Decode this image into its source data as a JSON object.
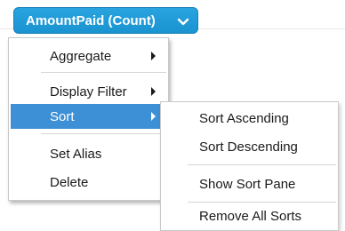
{
  "field_pill": {
    "label": "AmountPaid (Count)",
    "caret_icon": "chevron-down-icon",
    "color": "#1f9ad8"
  },
  "context_menu": {
    "items": [
      {
        "label": "Aggregate",
        "has_submenu": true
      },
      {
        "label": "Display Filter",
        "has_submenu": true
      },
      {
        "label": "Sort",
        "has_submenu": true,
        "highlighted": true
      },
      {
        "label": "Set Alias",
        "has_submenu": false
      },
      {
        "label": "Delete",
        "has_submenu": false
      }
    ],
    "highlight_color": "#3d8fd6"
  },
  "sort_submenu": {
    "items": [
      {
        "label": "Sort Ascending"
      },
      {
        "label": "Sort Descending"
      },
      {
        "label": "Show Sort Pane"
      },
      {
        "label": "Remove All Sorts"
      }
    ]
  }
}
